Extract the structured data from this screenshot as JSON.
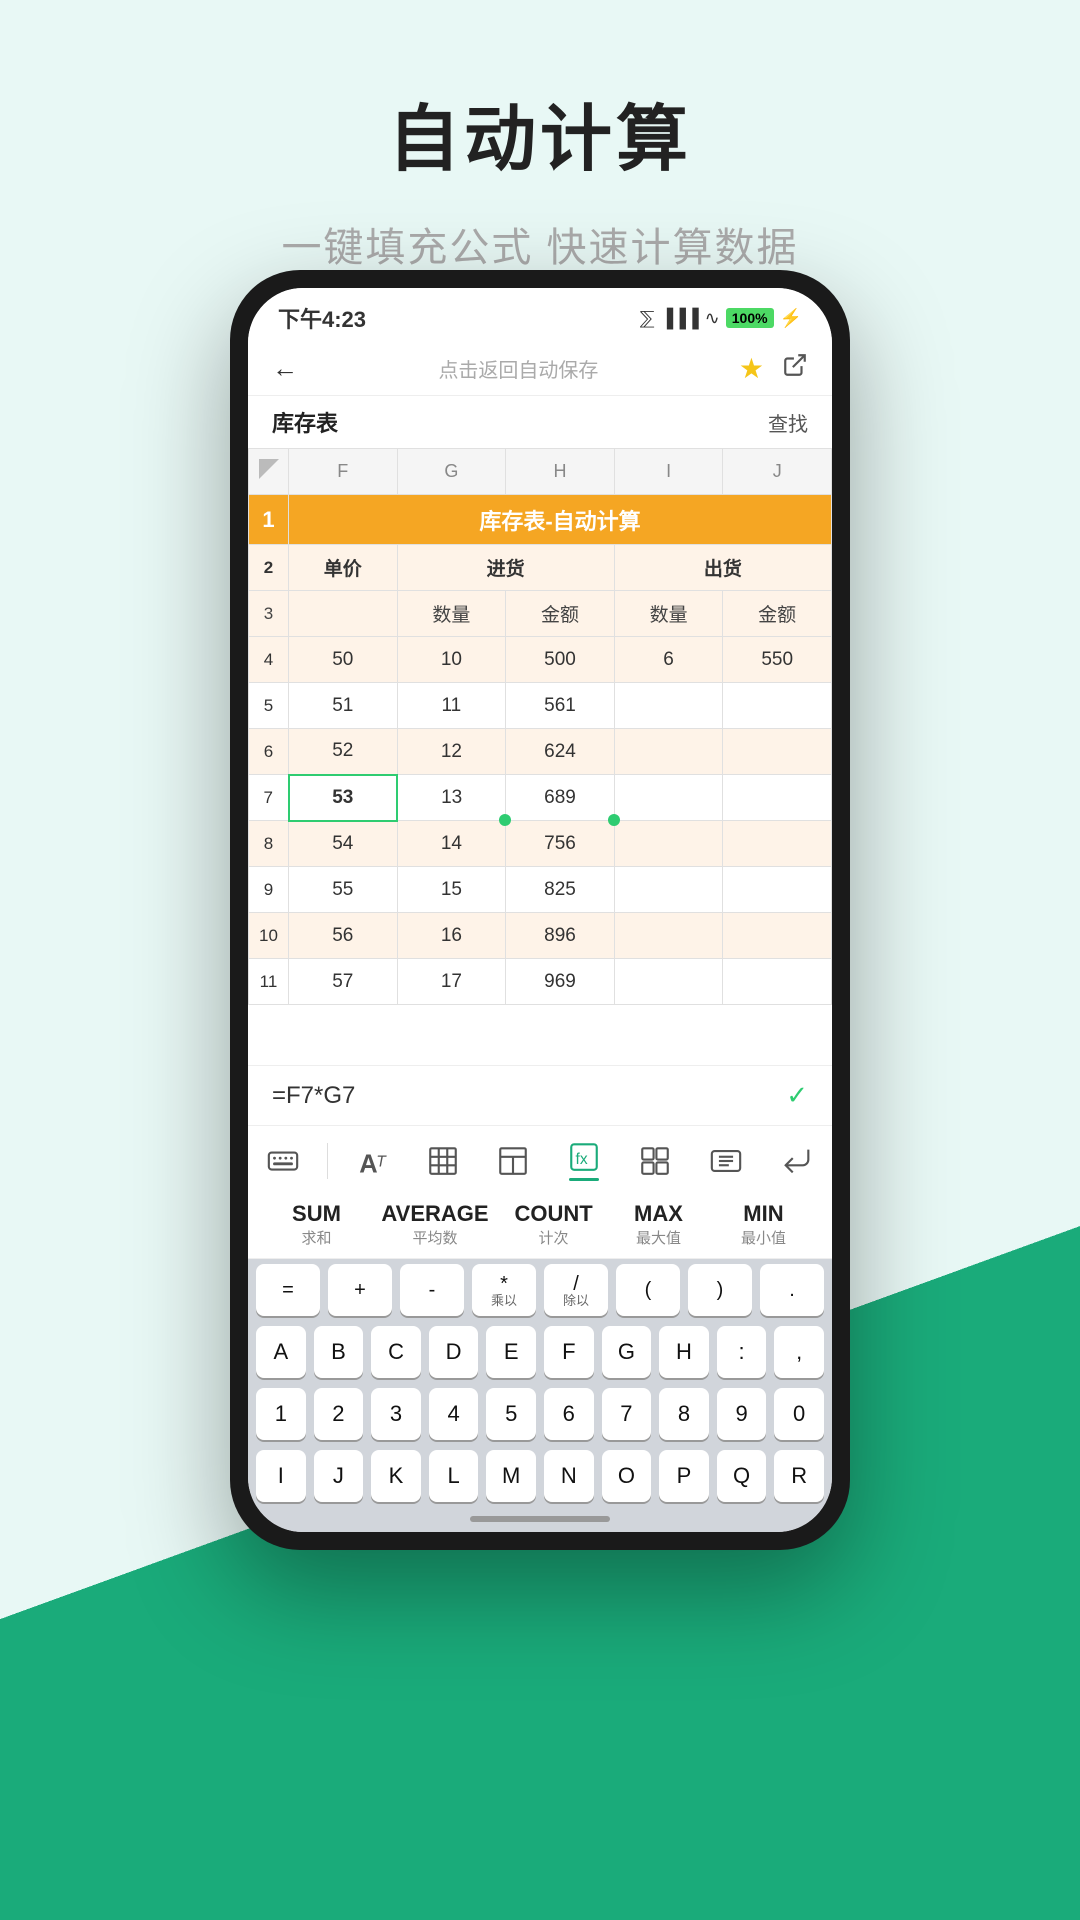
{
  "page": {
    "title": "自动计算",
    "subtitle": "一键填充公式 快速计算数据"
  },
  "status_bar": {
    "time": "下午4:23",
    "battery": "100"
  },
  "nav": {
    "back": "←",
    "center_text": "点击返回自动保存",
    "star": "★",
    "share": "⤴"
  },
  "sheet": {
    "title": "库存表",
    "find": "查找",
    "table_title": "库存表-自动计算",
    "col_headers": [
      "",
      "F",
      "G",
      "H",
      "I",
      "J"
    ],
    "headers": {
      "row2": [
        "",
        "单价",
        "进货",
        "",
        "出货",
        ""
      ],
      "row3": [
        "",
        "",
        "数量",
        "金额",
        "数量",
        "金额"
      ]
    },
    "data": [
      {
        "row": 4,
        "cells": [
          "50",
          "10",
          "500",
          "6",
          "550"
        ],
        "shaded": true
      },
      {
        "row": 5,
        "cells": [
          "51",
          "11",
          "561",
          "",
          ""
        ],
        "shaded": false
      },
      {
        "row": 6,
        "cells": [
          "52",
          "12",
          "624",
          "",
          ""
        ],
        "shaded": true
      },
      {
        "row": 7,
        "cells": [
          "53",
          "13",
          "689",
          "",
          ""
        ],
        "selected_col": 0,
        "shaded": false
      },
      {
        "row": 8,
        "cells": [
          "54",
          "14",
          "756",
          "",
          ""
        ],
        "shaded": true
      },
      {
        "row": 9,
        "cells": [
          "55",
          "15",
          "825",
          "",
          ""
        ],
        "shaded": false
      },
      {
        "row": 10,
        "cells": [
          "56",
          "16",
          "896",
          "",
          ""
        ],
        "shaded": true
      },
      {
        "row": 11,
        "cells": [
          "57",
          "17",
          "969",
          "",
          ""
        ],
        "shaded": false
      }
    ]
  },
  "formula_bar": {
    "text": "=F7*G7",
    "confirm": "✓"
  },
  "toolbar": {
    "items": [
      {
        "name": "keyboard-icon",
        "symbol": "⌨"
      },
      {
        "name": "text-format-icon",
        "symbol": "A",
        "sub": "T"
      },
      {
        "name": "table-icon",
        "symbol": "⊞"
      },
      {
        "name": "layout-icon",
        "symbol": "▣"
      },
      {
        "name": "formula-icon",
        "symbol": "⊘",
        "active": true
      },
      {
        "name": "elements-icon",
        "symbol": "⠿"
      },
      {
        "name": "more-icon",
        "symbol": "⊟"
      },
      {
        "name": "enter-icon",
        "symbol": "↵"
      }
    ]
  },
  "functions": [
    {
      "name": "SUM",
      "sub": "求和"
    },
    {
      "name": "AVERAGE",
      "sub": "平均数"
    },
    {
      "name": "COUNT",
      "sub": "计次"
    },
    {
      "name": "MAX",
      "sub": "最大值"
    },
    {
      "name": "MIN",
      "sub": "最小值"
    }
  ],
  "keyboard_rows": [
    [
      {
        "label": "="
      },
      {
        "label": "+"
      },
      {
        "label": "-"
      },
      {
        "label": "*",
        "sub": "乘以"
      },
      {
        "label": "/",
        "sub": "除以"
      },
      {
        "label": "("
      },
      {
        "label": ")"
      },
      {
        "label": "."
      }
    ],
    [
      {
        "label": "A"
      },
      {
        "label": "B"
      },
      {
        "label": "C"
      },
      {
        "label": "D"
      },
      {
        "label": "E"
      },
      {
        "label": "F"
      },
      {
        "label": "G"
      },
      {
        "label": "H"
      },
      {
        "label": ":"
      },
      {
        "label": ","
      }
    ],
    [
      {
        "label": "1"
      },
      {
        "label": "2"
      },
      {
        "label": "3"
      },
      {
        "label": "4"
      },
      {
        "label": "5"
      },
      {
        "label": "6"
      },
      {
        "label": "7"
      },
      {
        "label": "8"
      },
      {
        "label": "9"
      },
      {
        "label": "0"
      }
    ],
    [
      {
        "label": "I"
      },
      {
        "label": "J"
      },
      {
        "label": "K"
      },
      {
        "label": "L"
      },
      {
        "label": "M"
      },
      {
        "label": "N"
      },
      {
        "label": "O"
      },
      {
        "label": "P"
      },
      {
        "label": "Q"
      },
      {
        "label": "R"
      }
    ]
  ]
}
